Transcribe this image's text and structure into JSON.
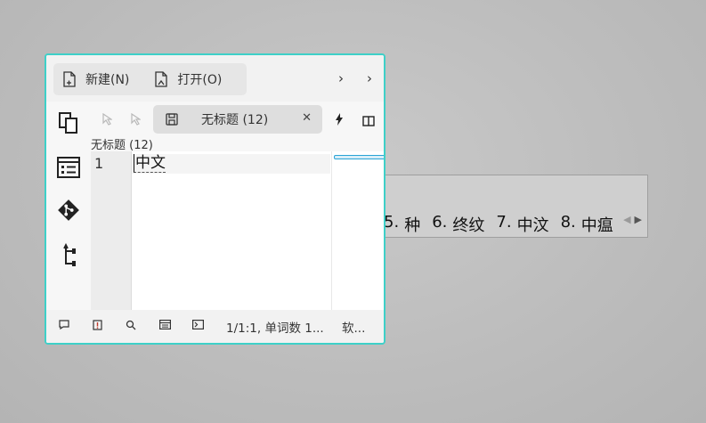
{
  "ime": {
    "candidates": [
      {
        "num": "5.",
        "text": "种"
      },
      {
        "num": "6.",
        "text": "终纹"
      },
      {
        "num": "7.",
        "text": "中汶"
      },
      {
        "num": "8.",
        "text": "中瘟"
      }
    ]
  },
  "toolbar": {
    "new_label": "新建(N)",
    "open_label": "打开(O)",
    "chevron_1": "›",
    "chevron_2": "›"
  },
  "tab": {
    "title": "无标题 (12)",
    "close": "✕"
  },
  "breadcrumb": "无标题 (12)",
  "editor": {
    "line_number": "1",
    "line_text": "中文"
  },
  "statusbar": {
    "position": "1/1:1, 单词数 1...",
    "encoding": "软..."
  },
  "colors": {
    "window_border": "#3ed0c8",
    "minimap_indicator": "#2aa3d6"
  }
}
